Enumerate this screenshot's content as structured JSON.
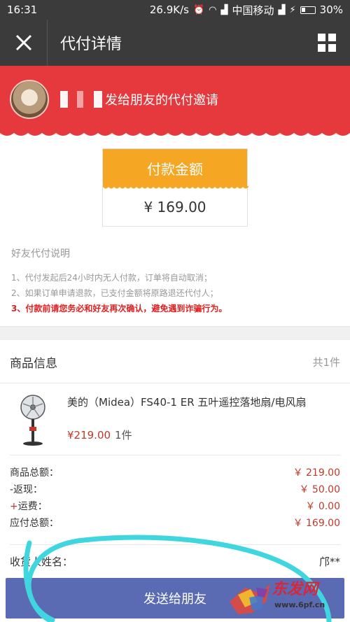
{
  "status_bar": {
    "time": "16:31",
    "speed": "26.9K/s",
    "carrier": "中国移动",
    "battery": "30%"
  },
  "nav": {
    "title": "代付详情"
  },
  "banner": {
    "message": "发给朋友的代付邀请"
  },
  "payment_card": {
    "label": "付款金额",
    "amount": "¥ 169.00"
  },
  "explanation": {
    "title": "好友代付说明",
    "items": [
      "1、代付发起后24小时内无人付款，订单将自动取消；",
      "2、如果订单申请退款，已支付金额将原路退还代付人；"
    ],
    "warning": "3、付款前请您务必和好友再次确认，避免遇到诈骗行为。"
  },
  "goods": {
    "label": "商品信息",
    "count": "共1件",
    "product": {
      "name": "美的（Midea）FS40-1 ER 五叶遥控落地扇/电风扇",
      "price": "¥219.00",
      "qty": "1件"
    }
  },
  "summary": {
    "rows": [
      {
        "label": "商品总额：",
        "value": "￥ 219.00"
      },
      {
        "label": "-返现：",
        "value": "￥ 50.00"
      },
      {
        "label": "运费：",
        "value": "￥ 0.00",
        "prefix": "+"
      },
      {
        "label": "应付总额：",
        "value": "￥ 169.00"
      }
    ]
  },
  "receiver": {
    "label": "收货人姓名：",
    "value": "邝**"
  },
  "send_button": {
    "label": "发送给朋友"
  },
  "watermark": {
    "brand": "东发网",
    "url": "www.6pf.cn"
  },
  "colors": {
    "nav_bg": "#3b3b3b",
    "banner_red": "#e5393e",
    "pay_orange": "#f5a623",
    "price_red": "#c0392b",
    "button_blue": "#5b6bb3",
    "marker_cyan": "#3fd6e0"
  }
}
